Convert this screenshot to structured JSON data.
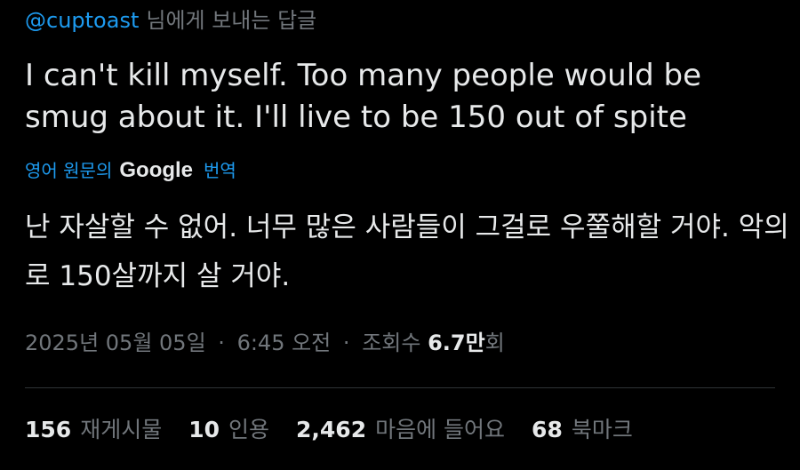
{
  "reply": {
    "handle": "@cuptoast",
    "suffix": "님에게 보내는 답글"
  },
  "tweet": {
    "text": "I can't kill myself. Too many people would be smug about it. I'll live to be 150 out of spite"
  },
  "translation": {
    "prefix": "영어 원문의",
    "provider": "Google",
    "action": "번역",
    "text": "난 자살할 수 없어. 너무 많은 사람들이 그걸로 우쭐해할 거야. 악의로 150살까지 살 거야."
  },
  "meta": {
    "date": "2025년 05월 05일",
    "time": "6:45 오전",
    "views_label": "조회수",
    "views_count": "6.7만",
    "views_suffix": "회",
    "separator": "·"
  },
  "stats": [
    {
      "count": "156",
      "label": "재게시물"
    },
    {
      "count": "10",
      "label": "인용"
    },
    {
      "count": "2,462",
      "label": "마음에 들어요"
    },
    {
      "count": "68",
      "label": "북마크"
    }
  ],
  "colors": {
    "background": "#000000",
    "text_primary": "#e7e9ea",
    "text_secondary": "#71767b",
    "accent": "#1d9bf0",
    "divider": "#2f3336"
  }
}
